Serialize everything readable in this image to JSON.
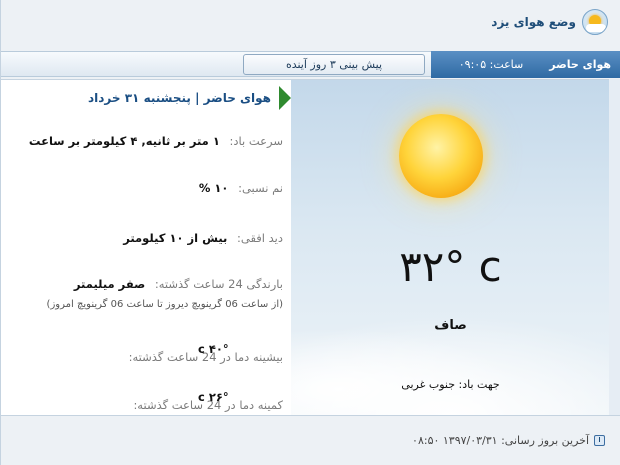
{
  "header": {
    "title": "وضع هوای یزد",
    "logo_icon": "sun-cloud-icon"
  },
  "tabs": {
    "current_label": "هوای حاضر",
    "time_label": "ساعت:",
    "time_value": "۰۹:۰۵",
    "forecast_label": "پیش بینی ۳ روز آینده"
  },
  "details": {
    "date_heading": "هوای حاضر | پنجشنبه ۳۱ خرداد",
    "wind_speed_label": "سرعت باد:",
    "wind_speed_value": "۱ متر بر ثانیه, ۴ کیلومتر بر ساعت",
    "humidity_label": "نم نسبی:",
    "humidity_value": "۱۰ %",
    "visibility_label": "دید افقی:",
    "visibility_value": "بیش از ۱۰ کیلومتر",
    "rain_label": "بارندگی 24 ساعت گذشته:",
    "rain_value": "صفر میلیمتر",
    "rain_note": "(از ساعت 06 گرینویچ دیروز تا ساعت 06 گرینویچ امروز)",
    "max_temp_label": "بیشینه دما در 24 ساعت گذشته:",
    "max_temp_value": "۴۰° c",
    "min_temp_label": "کمینه دما در 24 ساعت گذشته:",
    "min_temp_value": "۲۶° c"
  },
  "current": {
    "temperature": "۳۲° c",
    "condition": "صاف",
    "wind_direction": "جهت باد: جنوب غربی",
    "icon": "sun-icon"
  },
  "footer": {
    "last_update": "آخرین بروز رسانی: ۱۳۹۷/۰۳/۳۱ ۰۸:۵۰",
    "icon": "clock-icon"
  },
  "colors": {
    "accent": "#2f6aa3",
    "title": "#1f4e79",
    "flag": "#2f8a2f"
  }
}
